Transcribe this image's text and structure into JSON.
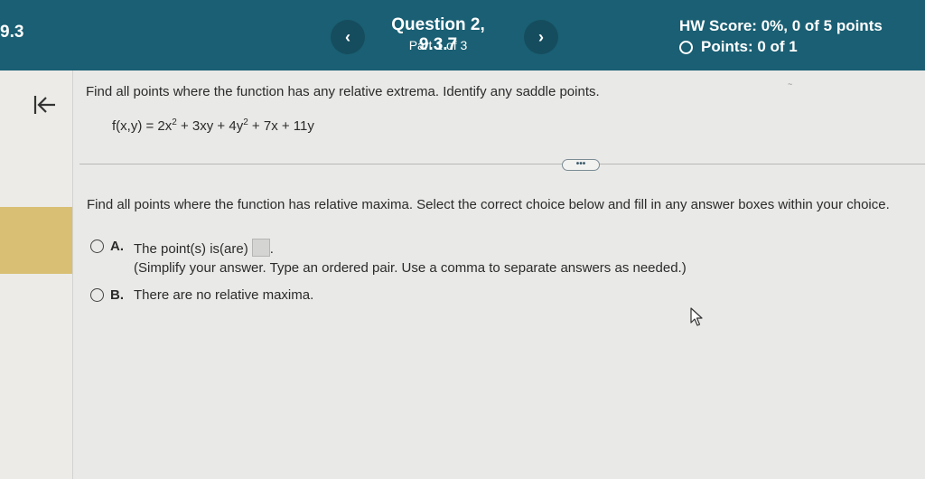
{
  "header": {
    "section": "9.3",
    "question_title": "Question 2, 9.3.7",
    "part": "Part 1 of 3",
    "hw_score": "HW Score: 0%, 0 of 5 points",
    "points": "Points: 0 of 1",
    "prev_symbol": "‹",
    "next_symbol": "›"
  },
  "question": {
    "prompt": "Find all points where the function has any relative extrema. Identify any saddle points.",
    "function": {
      "lhs": "f(x,y) = 2x",
      "exp1": "2",
      "mid": " + 3xy + 4y",
      "exp2": "2",
      "rhs": " + 7x + 11y"
    },
    "more_label": "•••"
  },
  "part": {
    "instruction": "Find all points where the function has relative maxima. Select the correct choice below and fill in any answer boxes within your choice.",
    "choices": [
      {
        "letter": "A.",
        "text": "The point(s) is(are)",
        "after_box": ".",
        "hint": "(Simplify your answer. Type an ordered pair. Use a comma to separate answers as needed.)"
      },
      {
        "letter": "B.",
        "text": "There are no relative maxima."
      }
    ]
  },
  "colors": {
    "header_bg": "#1a5f73",
    "rail_highlight": "#d8bf73",
    "page_bg": "#e9e9e7"
  },
  "icons": {
    "back": "back-to-start-icon",
    "points": "circle-outline-icon",
    "cursor": "mouse-pointer-icon"
  }
}
